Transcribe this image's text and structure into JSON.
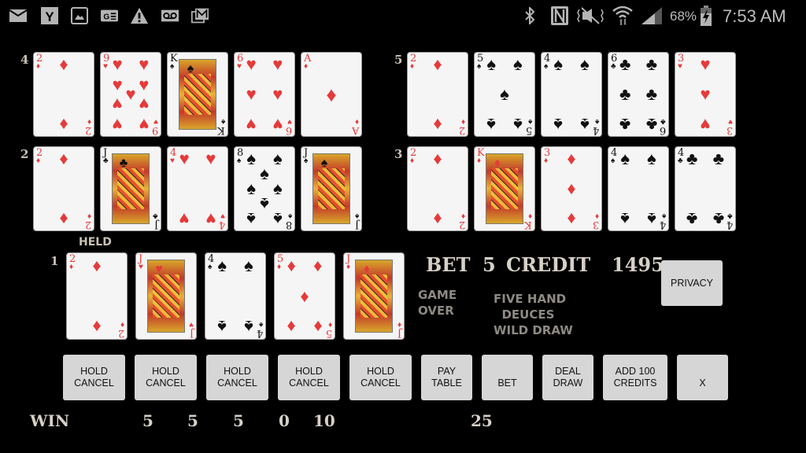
{
  "status_bar": {
    "left_icons": [
      "email-icon",
      "yahoo-icon",
      "gallery-icon",
      "google-news-icon",
      "warning-icon",
      "voicemail-icon",
      "gmail-icon"
    ],
    "right_icons": [
      "bluetooth-icon",
      "nfc-icon",
      "vibrate-icon",
      "wifi-icon",
      "signal-icon",
      "battery-charging-icon"
    ],
    "battery": "68%",
    "time": "7:53 AM"
  },
  "hands": [
    {
      "number": "4",
      "cards": [
        {
          "rank": "2",
          "suit": "diamonds"
        },
        {
          "rank": "9",
          "suit": "hearts"
        },
        {
          "rank": "K",
          "suit": "spades"
        },
        {
          "rank": "6",
          "suit": "hearts"
        },
        {
          "rank": "A",
          "suit": "diamonds"
        }
      ]
    },
    {
      "number": "5",
      "cards": [
        {
          "rank": "2",
          "suit": "diamonds"
        },
        {
          "rank": "5",
          "suit": "spades"
        },
        {
          "rank": "4",
          "suit": "spades"
        },
        {
          "rank": "6",
          "suit": "clubs"
        },
        {
          "rank": "3",
          "suit": "hearts"
        }
      ]
    },
    {
      "number": "2",
      "cards": [
        {
          "rank": "2",
          "suit": "diamonds"
        },
        {
          "rank": "J",
          "suit": "clubs"
        },
        {
          "rank": "4",
          "suit": "hearts"
        },
        {
          "rank": "8",
          "suit": "spades"
        },
        {
          "rank": "J",
          "suit": "spades"
        }
      ]
    },
    {
      "number": "3",
      "cards": [
        {
          "rank": "2",
          "suit": "diamonds"
        },
        {
          "rank": "K",
          "suit": "diamonds"
        },
        {
          "rank": "3",
          "suit": "diamonds"
        },
        {
          "rank": "4",
          "suit": "spades"
        },
        {
          "rank": "4",
          "suit": "clubs"
        }
      ]
    },
    {
      "number": "1",
      "cards": [
        {
          "rank": "2",
          "suit": "diamonds"
        },
        {
          "rank": "J",
          "suit": "hearts"
        },
        {
          "rank": "4",
          "suit": "spades"
        },
        {
          "rank": "5",
          "suit": "diamonds"
        },
        {
          "rank": "J",
          "suit": "diamonds"
        }
      ]
    }
  ],
  "held_label": "HELD",
  "info": {
    "bet_label": "BET",
    "bet_value": "5",
    "credit_label": "CREDIT",
    "credit_value": "1495",
    "game_status": "GAME\nOVER",
    "game_name": "FIVE HAND\n  DEUCES\nWILD DRAW"
  },
  "buttons": {
    "privacy": "PRIVACY",
    "hold_cancel": [
      "HOLD\nCANCEL",
      "HOLD\nCANCEL",
      "HOLD\nCANCEL",
      "HOLD\nCANCEL",
      "HOLD\nCANCEL"
    ],
    "pay_table": "PAY\nTABLE",
    "bet": "BET",
    "deal_draw": "DEAL\nDRAW",
    "add_credits": "ADD 100\nCREDITS",
    "exit": "X"
  },
  "wins": {
    "label": "WIN",
    "values": [
      "5",
      "5",
      "5",
      "0",
      "10"
    ],
    "total": "25"
  }
}
